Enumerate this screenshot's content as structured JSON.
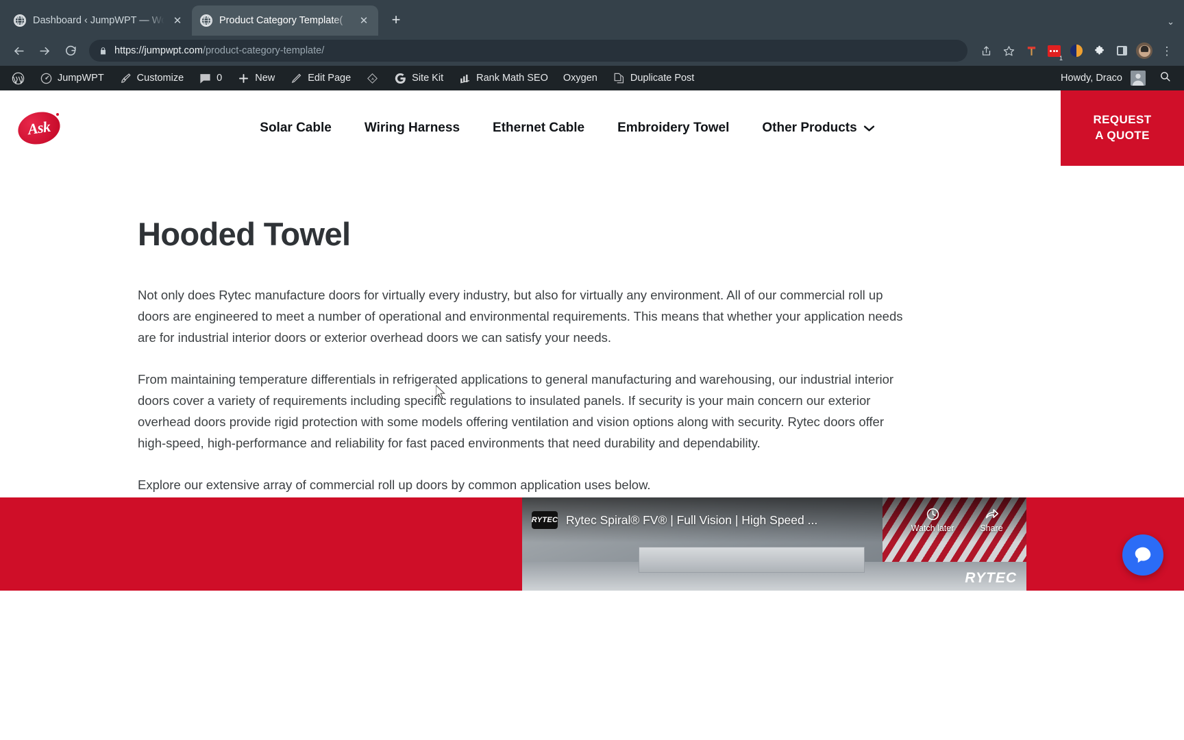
{
  "browser": {
    "tabs": [
      {
        "title": "Dashboard ‹ JumpWPT — Wor",
        "favicon": "globe-icon",
        "active": false
      },
      {
        "title": "Product Category Template(",
        "favicon": "globe-icon",
        "active": true
      }
    ],
    "new_tab_label": "+",
    "tabstrip_menu": "⌄",
    "nav": {
      "back": "back-arrow-icon",
      "forward": "forward-arrow-icon",
      "reload": "reload-icon"
    },
    "address": {
      "lock": "lock-icon",
      "scheme_host": "https://jumpwpt.com",
      "path": "/product-category-template/",
      "full": "https://jumpwpt.com/product-category-template/"
    },
    "omnibox_icons": [
      {
        "name": "share-icon"
      },
      {
        "name": "bookmark-star-icon"
      }
    ],
    "extensions": [
      {
        "name": "hammer-extension-icon",
        "badge": ""
      },
      {
        "name": "red-dots-extension-icon",
        "badge": "1"
      },
      {
        "name": "yin-yang-extension-icon",
        "badge": ""
      },
      {
        "name": "puzzle-extensions-icon",
        "badge": ""
      },
      {
        "name": "side-panel-icon",
        "badge": ""
      }
    ],
    "profile": "profile-avatar",
    "menu": "kebab-menu-icon"
  },
  "adminbar": {
    "items": [
      {
        "icon": "wordpress-logo-icon",
        "label": ""
      },
      {
        "icon": "dashboard-speedometer-icon",
        "label": "JumpWPT"
      },
      {
        "icon": "paintbrush-icon",
        "label": "Customize"
      },
      {
        "icon": "comment-bubble-icon",
        "label": "0"
      },
      {
        "icon": "plus-icon",
        "label": "New"
      },
      {
        "icon": "pencil-icon",
        "label": "Edit Page"
      },
      {
        "icon": "diamond-icon",
        "label": ""
      },
      {
        "icon": "google-g-icon",
        "label": "Site Kit"
      },
      {
        "icon": "rank-math-icon",
        "label": "Rank Math SEO"
      },
      {
        "icon": "",
        "label": "Oxygen"
      },
      {
        "icon": "duplicate-pages-icon",
        "label": "Duplicate Post"
      }
    ],
    "howdy": "Howdy, Draco",
    "avatar": "user-avatar",
    "search_icon": "search-icon"
  },
  "site": {
    "logo": {
      "text": "Ask",
      "color": "#d00f29"
    },
    "nav": [
      {
        "label": "Solar Cable",
        "has_dropdown": false
      },
      {
        "label": "Wiring Harness",
        "has_dropdown": false
      },
      {
        "label": "Ethernet Cable",
        "has_dropdown": false
      },
      {
        "label": "Embroidery Towel",
        "has_dropdown": false
      },
      {
        "label": "Other Products",
        "has_dropdown": true
      }
    ],
    "cta": {
      "line1": "REQUEST",
      "line2": "A QUOTE",
      "color": "#d00f29"
    }
  },
  "page": {
    "title": "Hooded Towel",
    "paragraphs": [
      "Not only does Rytec manufacture doors for virtually every industry, but also for virtually any environment. All of our commercial roll up doors are engineered to meet a number of operational and environmental requirements. This means that whether your application needs are for industrial interior doors or exterior overhead doors we can satisfy your needs.",
      "From maintaining temperature differentials in refrigerated applications to general manufacturing and warehousing, our industrial interior doors cover a variety of requirements including specific regulations to insulated panels. If security is your main concern our exterior overhead doors provide rigid protection with some models offering ventilation and vision options along with security. Rytec doors offer high-speed, high-performance and reliability for fast paced environments that need durability and dependability.",
      "Explore our extensive array of commercial roll up doors by common application uses below."
    ],
    "quote_button": "Request a Quote"
  },
  "video": {
    "channel_badge": "RYTEC",
    "title": "Rytec Spiral® FV® | Full Vision | High Speed ...",
    "watch_later": "Watch later",
    "share": "Share",
    "overlay_logo": "RYTEC"
  },
  "widgets": {
    "chat": {
      "name": "chat-widget",
      "color": "#2b6cf6"
    }
  }
}
